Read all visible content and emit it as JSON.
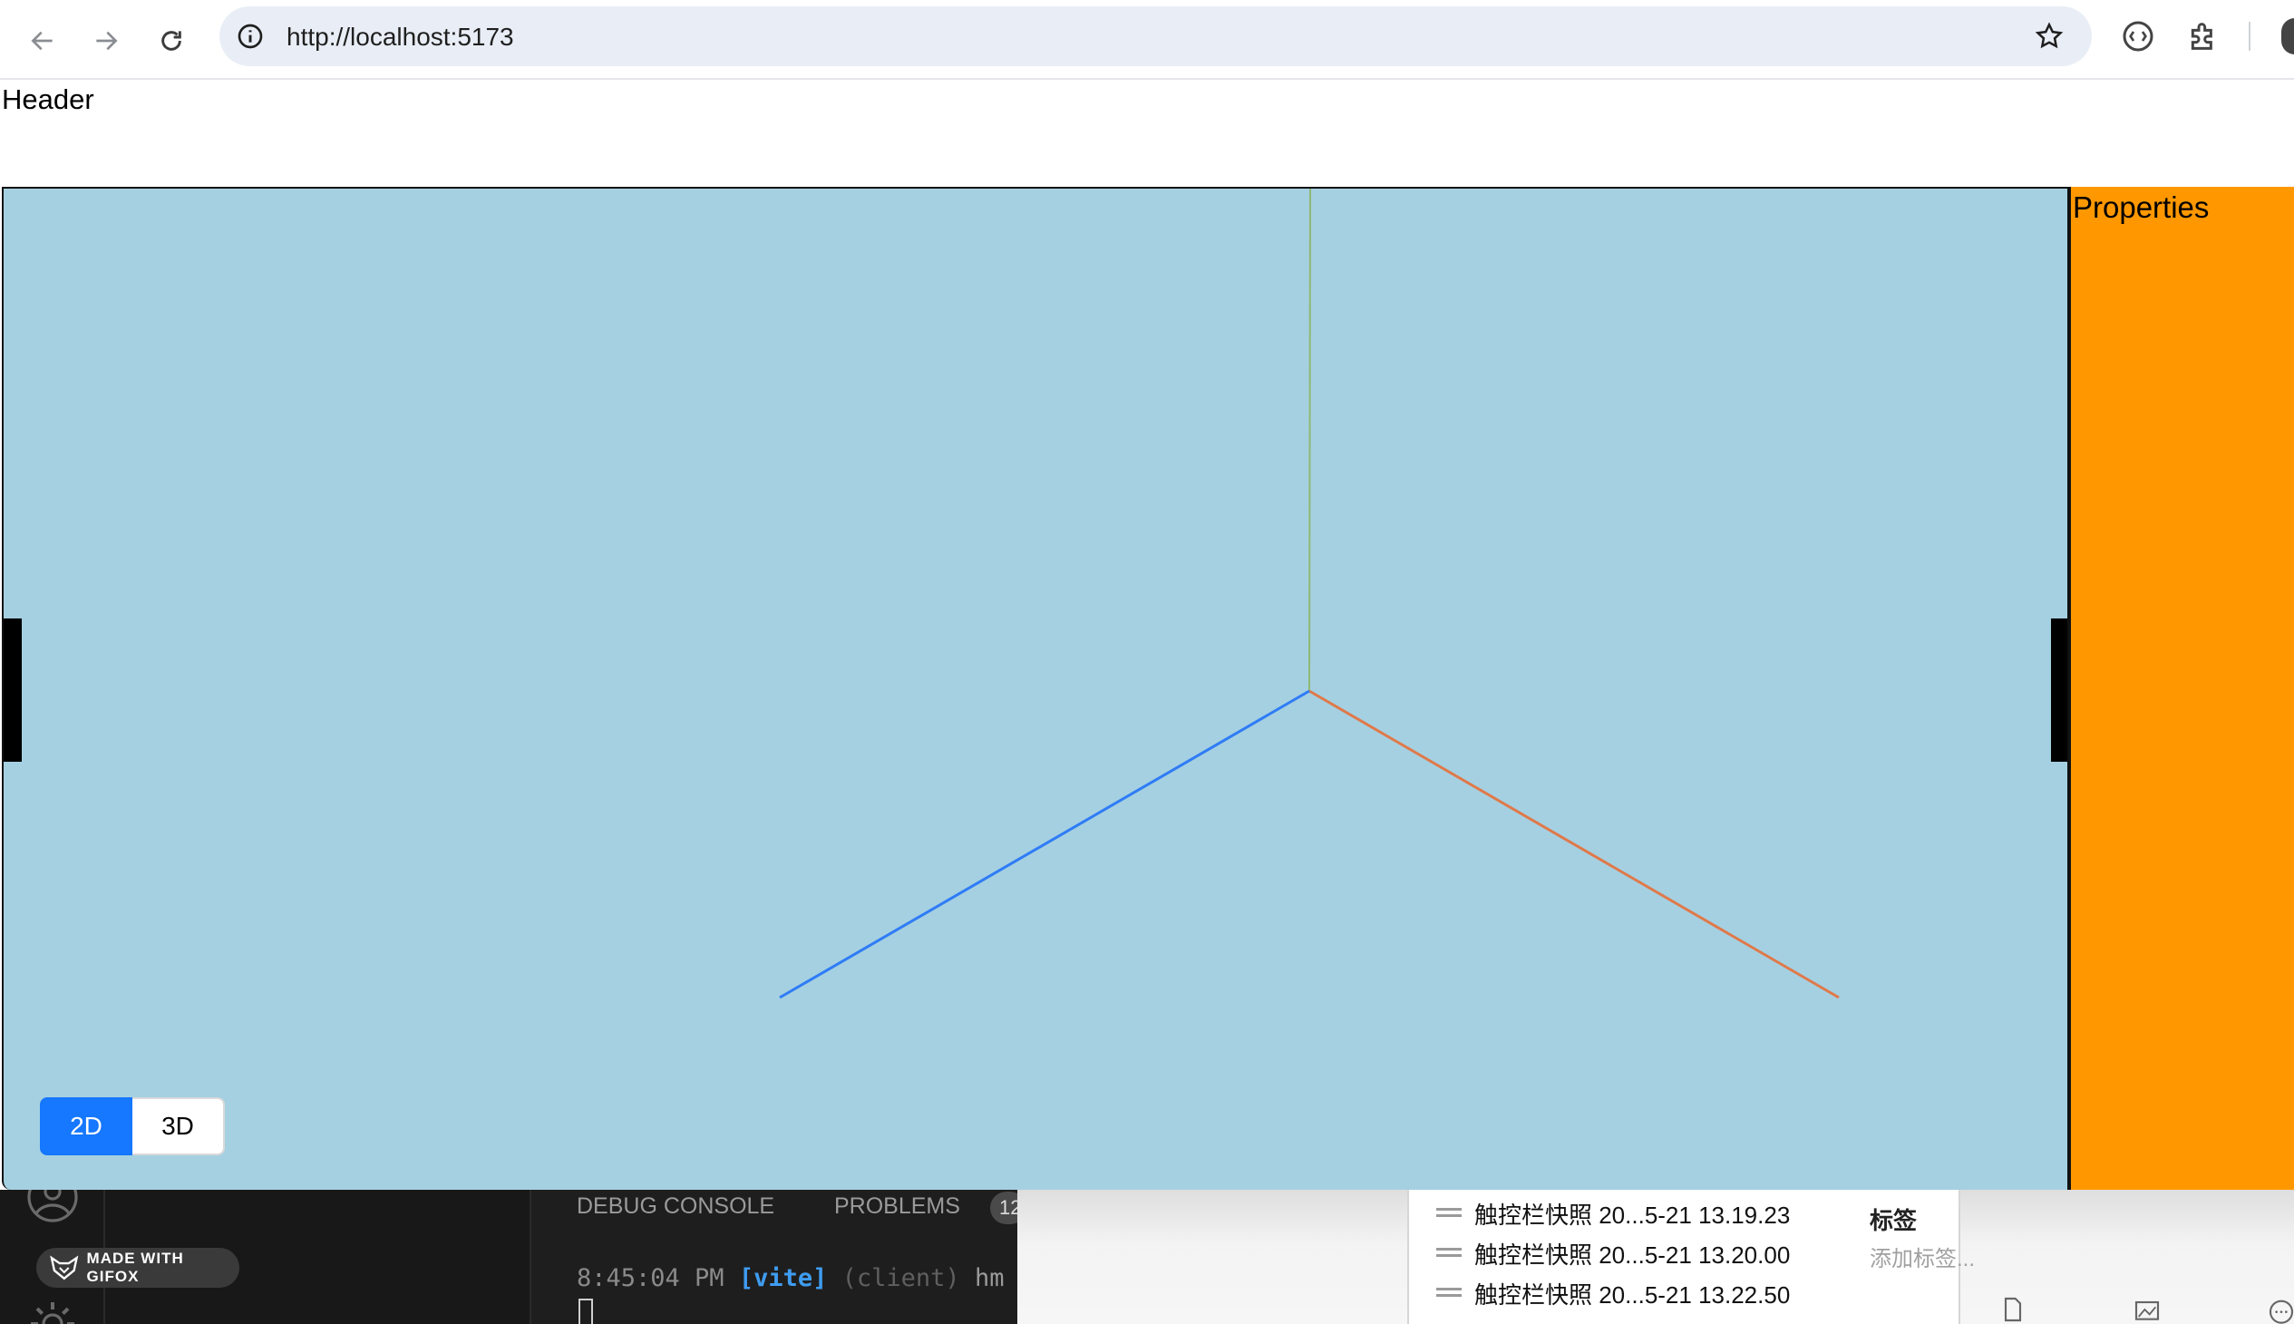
{
  "browser": {
    "url": "http://localhost:5173"
  },
  "app": {
    "header": "Header",
    "properties_title": "Properties",
    "viewport": {
      "background": "#a5d0e1",
      "axes": {
        "x_color": "#e0794a",
        "y_color": "#8fb874",
        "z_color": "#2f7cf6"
      }
    },
    "view_toggle": {
      "btn_2d": "2D",
      "btn_3d": "3D",
      "active": "2D",
      "active_color": "#1677ff"
    },
    "properties_color": "#ff9800"
  },
  "desktop": {
    "vscode": {
      "tab_debug": "DEBUG CONSOLE",
      "tab_problems": "PROBLEMS",
      "problems_badge": "12",
      "terminal": {
        "time": "8:45:04 PM",
        "tag": "[vite]",
        "client": "(client)",
        "rest": "hm"
      }
    },
    "gifox_badge": "MADE WITH GIFOX",
    "finder": {
      "files": [
        "触控栏快照 20...5-21 13.19.23",
        "触控栏快照 20...5-21 13.20.00",
        "触控栏快照 20...5-21 13.22.50"
      ],
      "tags_title": "标签",
      "tags_placeholder": "添加标签..."
    }
  }
}
